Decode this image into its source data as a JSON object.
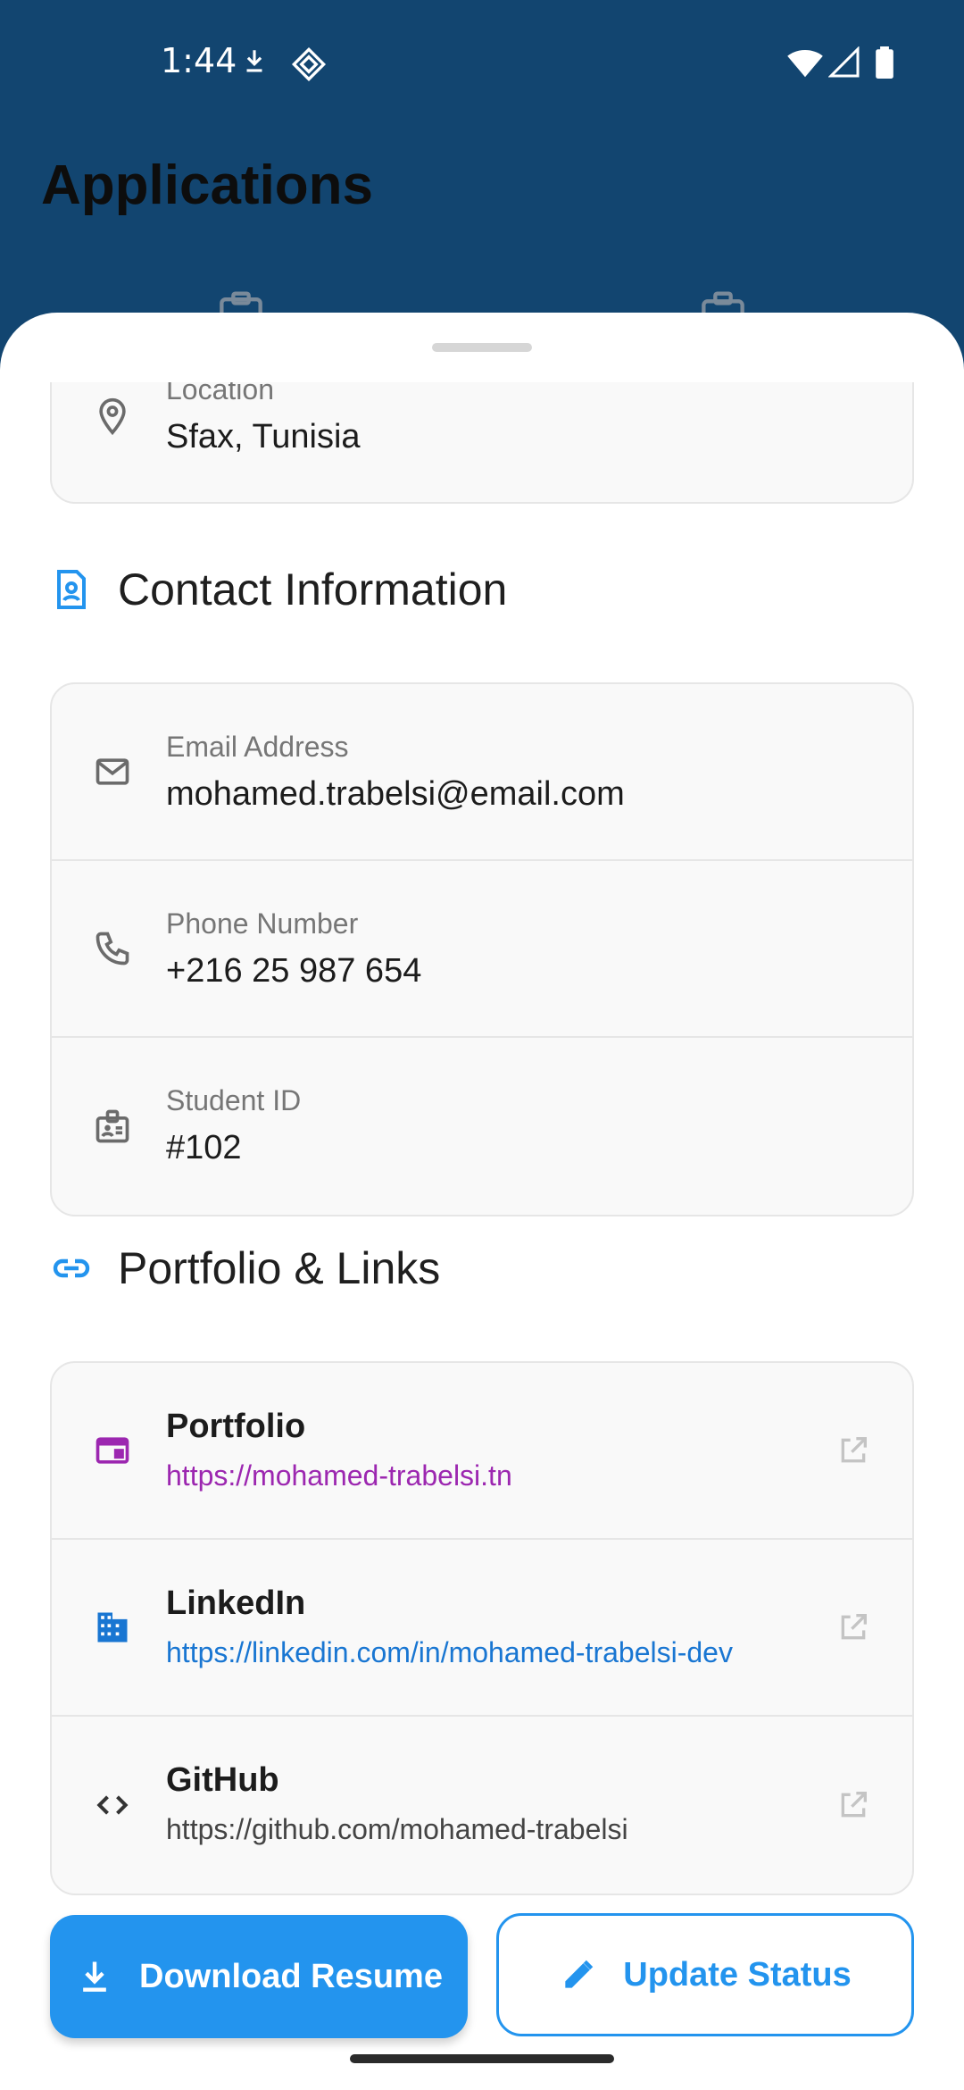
{
  "status_bar": {
    "time": "1:44"
  },
  "header": {
    "title": "Applications"
  },
  "location": {
    "label": "Location",
    "value": "Sfax, Tunisia"
  },
  "contact": {
    "section_title": "Contact Information",
    "email_label": "Email Address",
    "email_value": "mohamed.trabelsi@email.com",
    "phone_label": "Phone Number",
    "phone_value": "+216 25 987 654",
    "student_id_label": "Student ID",
    "student_id_value": "#102"
  },
  "links": {
    "section_title": "Portfolio & Links",
    "items": [
      {
        "title": "Portfolio",
        "url": "https://mohamed-trabelsi.tn",
        "color": "#9c27b0",
        "icon": "web-icon"
      },
      {
        "title": "LinkedIn",
        "url": "https://linkedin.com/in/mohamed-trabelsi-dev",
        "color": "#1976d2",
        "icon": "business-icon"
      },
      {
        "title": "GitHub",
        "url": "https://github.com/mohamed-trabelsi",
        "color": "#444444",
        "icon": "code-icon"
      }
    ]
  },
  "actions": {
    "download_label": "Download Resume",
    "update_label": "Update Status"
  },
  "colors": {
    "header_bg": "#124570",
    "accent": "#2394ee"
  }
}
